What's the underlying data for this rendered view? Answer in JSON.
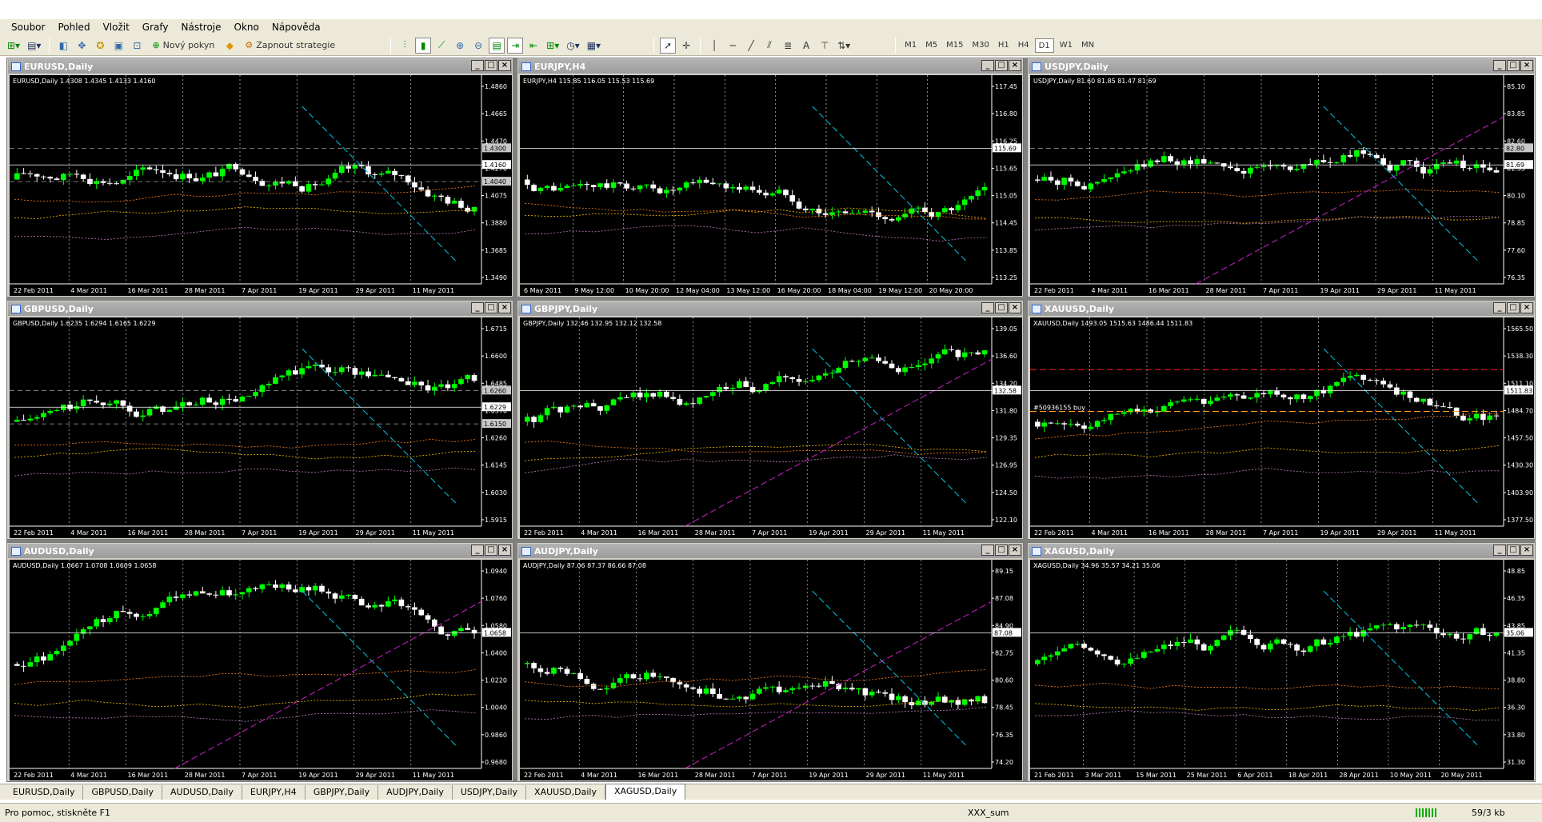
{
  "menu": [
    "Soubor",
    "Pohled",
    "Vložit",
    "Grafy",
    "Nástroje",
    "Okno",
    "Nápověda"
  ],
  "toolbar": {
    "new_order": "Nový pokyn",
    "start_strategy": "Zapnout strategie",
    "timeframes": [
      "M1",
      "M5",
      "M15",
      "M30",
      "H1",
      "H4",
      "D1",
      "W1",
      "MN"
    ],
    "active_timeframe": "D1"
  },
  "colors": {
    "bull": "#00ff00",
    "bear": "#ffffff",
    "bg": "#000000",
    "grid": "#c8c8c8",
    "trend": "#00c8e8",
    "channel": "#d020d0",
    "ema_fast": "#ff8020",
    "ema_slow": "#ffc000",
    "ma_long": "#c080c0"
  },
  "charts": [
    {
      "title": "EURUSD,Daily",
      "ohlc": "EURUSD,Daily  1.4308 1.4345 1.4133 1.4160",
      "prices": [
        "1.4860",
        "1.4665",
        "1.4470",
        "1.4270",
        "1.4075",
        "1.3880",
        "1.3685",
        "1.3490"
      ],
      "hlines": [
        {
          "label": "1.4300",
          "color": "#a0a0a0"
        },
        {
          "label": "1.4160",
          "color": "#ffffff"
        },
        {
          "label": "1.4040",
          "color": "#a0a0a0"
        }
      ],
      "dates": [
        "22 Feb 2011",
        "4 Mar 2011",
        "16 Mar 2011",
        "28 Mar 2011",
        "7 Apr 2011",
        "19 Apr 2011",
        "29 Apr 2011",
        "11 May 2011"
      ]
    },
    {
      "title": "EURJPY,H4",
      "ohlc": "EURJPY,H4  115.85 116.05 115.53 115.69",
      "prices": [
        "117.45",
        "116.80",
        "116.25",
        "115.65",
        "115.05",
        "114.45",
        "113.85",
        "113.25"
      ],
      "hlines": [
        {
          "label": "115.69",
          "color": "#ffffff"
        }
      ],
      "dates": [
        "6 May 2011",
        "9 May 12:00",
        "10 May 20:00",
        "12 May 04:00",
        "13 May 12:00",
        "16 May 20:00",
        "18 May 04:00",
        "19 May 12:00",
        "20 May 20:00"
      ]
    },
    {
      "title": "USDJPY,Daily",
      "ohlc": "USDJPY,Daily  81.60 81.85 81.47 81.69",
      "prices": [
        "85.10",
        "83.85",
        "82.60",
        "81.35",
        "80.10",
        "78.85",
        "77.60",
        "76.35"
      ],
      "hlines": [
        {
          "label": "82.80",
          "color": "#a0a0a0"
        },
        {
          "label": "81.69",
          "color": "#ffffff"
        }
      ],
      "dates": [
        "22 Feb 2011",
        "4 Mar 2011",
        "16 Mar 2011",
        "28 Mar 2011",
        "7 Apr 2011",
        "19 Apr 2011",
        "29 Apr 2011",
        "11 May 2011"
      ]
    },
    {
      "title": "GBPUSD,Daily",
      "ohlc": "GBPUSD,Daily  1.6235 1.6294 1.6165 1.6229",
      "prices": [
        "1.6715",
        "1.6600",
        "1.6485",
        "1.6370",
        "1.6260",
        "1.6145",
        "1.6030",
        "1.5915"
      ],
      "hlines": [
        {
          "label": "1.6260",
          "color": "#a0a0a0"
        },
        {
          "label": "1.6229",
          "color": "#ffffff"
        },
        {
          "label": "1.6150",
          "color": "#a0a0a0"
        }
      ],
      "dates": [
        "22 Feb 2011",
        "4 Mar 2011",
        "16 Mar 2011",
        "28 Mar 2011",
        "7 Apr 2011",
        "19 Apr 2011",
        "29 Apr 2011",
        "11 May 2011"
      ]
    },
    {
      "title": "GBPJPY,Daily",
      "ohlc": "GBPJPY,Daily  132.46 132.95 132.12 132.58",
      "prices": [
        "139.05",
        "136.60",
        "134.20",
        "131.80",
        "129.35",
        "126.95",
        "124.50",
        "122.10"
      ],
      "hlines": [
        {
          "label": "132.58",
          "color": "#ffffff"
        }
      ],
      "dates": [
        "22 Feb 2011",
        "4 Mar 2011",
        "16 Mar 2011",
        "28 Mar 2011",
        "7 Apr 2011",
        "19 Apr 2011",
        "29 Apr 2011",
        "11 May 2011"
      ]
    },
    {
      "title": "XAUUSD,Daily",
      "ohlc": "XAUUSD,Daily  1493.05 1515.63 1486.44 1511.83",
      "prices": [
        "1565.50",
        "1538.30",
        "1511.10",
        "1484.70",
        "1457.50",
        "1430.30",
        "1403.90",
        "1377.50"
      ],
      "hlines": [
        {
          "label": "1511.83",
          "color": "#ffffff"
        }
      ],
      "order_label": "#50936155 buy",
      "dates": [
        "22 Feb 2011",
        "4 Mar 2011",
        "16 Mar 2011",
        "28 Mar 2011",
        "7 Apr 2011",
        "19 Apr 2011",
        "29 Apr 2011",
        "11 May 2011"
      ]
    },
    {
      "title": "AUDUSD,Daily",
      "ohlc": "AUDUSD,Daily  1.0667 1.0708 1.0609 1.0658",
      "prices": [
        "1.0940",
        "1.0760",
        "1.0580",
        "1.0400",
        "1.0220",
        "1.0040",
        "0.9860",
        "0.9680"
      ],
      "hlines": [
        {
          "label": "1.0658",
          "color": "#ffffff"
        }
      ],
      "dates": [
        "22 Feb 2011",
        "4 Mar 2011",
        "16 Mar 2011",
        "28 Mar 2011",
        "7 Apr 2011",
        "19 Apr 2011",
        "29 Apr 2011",
        "11 May 2011"
      ]
    },
    {
      "title": "AUDJPY,Daily",
      "ohlc": "AUDJPY,Daily  87.06 87.37 86.66 87.08",
      "prices": [
        "89.15",
        "87.08",
        "84.90",
        "82.75",
        "80.60",
        "78.45",
        "76.35",
        "74.20"
      ],
      "hlines": [
        {
          "label": "87.08",
          "color": "#ffffff"
        }
      ],
      "dates": [
        "22 Feb 2011",
        "4 Mar 2011",
        "16 Mar 2011",
        "28 Mar 2011",
        "7 Apr 2011",
        "19 Apr 2011",
        "29 Apr 2011",
        "11 May 2011"
      ]
    },
    {
      "title": "XAGUSD,Daily",
      "ohlc": "XAGUSD,Daily  34.96 35.57 34.21 35.06",
      "prices": [
        "48.85",
        "46.35",
        "43.85",
        "41.35",
        "38.80",
        "36.30",
        "33.80",
        "31.30"
      ],
      "hlines": [
        {
          "label": "35.06",
          "color": "#ffffff"
        }
      ],
      "dates": [
        "21 Feb 2011",
        "3 Mar 2011",
        "15 Mar 2011",
        "25 Mar 2011",
        "6 Apr 2011",
        "18 Apr 2011",
        "28 Apr 2011",
        "10 May 2011",
        "20 May 2011"
      ]
    }
  ],
  "tabs": [
    "EURUSD,Daily",
    "GBPUSD,Daily",
    "AUDUSD,Daily",
    "EURJPY,H4",
    "GBPJPY,Daily",
    "AUDJPY,Daily",
    "USDJPY,Daily",
    "XAUUSD,Daily",
    "XAGUSD,Daily"
  ],
  "active_tab": "XAGUSD,Daily",
  "status": {
    "help": "Pro pomoc, stiskněte F1",
    "profile": "XXX_sum",
    "traffic": "59/3 kb"
  }
}
